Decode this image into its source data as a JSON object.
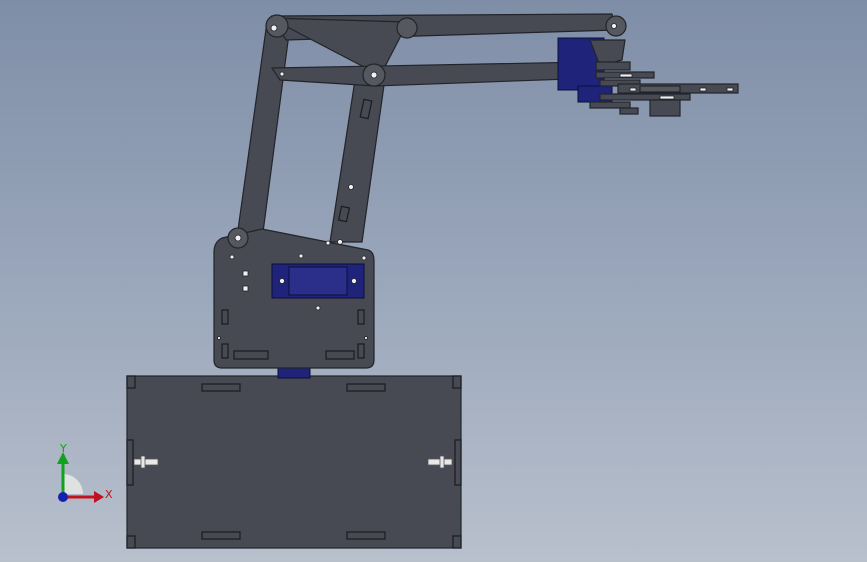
{
  "viewport": {
    "background_top": "#7f8ea7",
    "background_bottom": "#b8c0cc",
    "part_color": "#474a52",
    "part_edge": "#22242a",
    "servo_color": "#1f237a",
    "hole_color": "#f0f0f0"
  },
  "model": {
    "components": [
      "base-box",
      "base-plate",
      "shoulder-servo",
      "lower-arm",
      "upper-arm",
      "top-link",
      "gripper"
    ]
  },
  "triad": {
    "x_label": "X",
    "y_label": "Y",
    "x_color": "#c0121f",
    "y_color": "#12a01f",
    "z_color": "#1520b0"
  }
}
